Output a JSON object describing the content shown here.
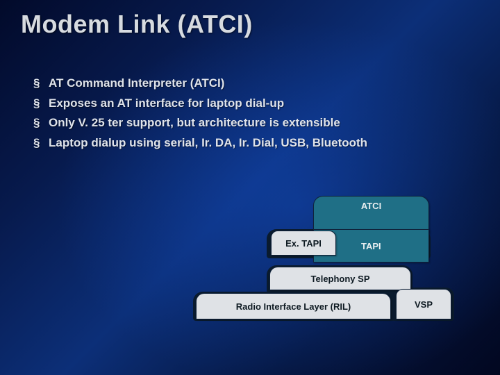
{
  "title": "Modem Link (ATCI)",
  "bullets": [
    "AT Command Interpreter (ATCI)",
    "Exposes an AT interface for laptop dial-up",
    "Only V. 25 ter support, but architecture is extensible",
    "Laptop dialup using serial, Ir. DA, Ir. Dial, USB, Bluetooth"
  ],
  "diagram": {
    "atci": "ATCI",
    "extapi": "Ex. TAPI",
    "tapi": "TAPI",
    "telephony_sp": "Telephony SP",
    "ril": "Radio Interface Layer (RIL)",
    "vsp": "VSP"
  },
  "colors": {
    "teal": "#1f6f86",
    "light": "#dfe2e6",
    "plate": "#0a1b2e"
  }
}
